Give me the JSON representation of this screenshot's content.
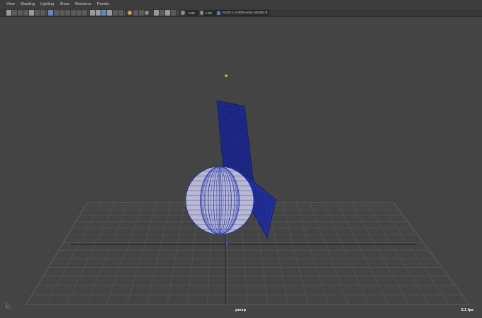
{
  "menu": {
    "items": [
      "View",
      "Shading",
      "Lighting",
      "Show",
      "Renderer",
      "Panels"
    ]
  },
  "toolbar": {
    "exposure": "0.00",
    "gamma": "1.00",
    "color_space": "ACES 1.0 SDR-video (sRGB)"
  },
  "viewport": {
    "camera": "persp",
    "fps": "5.1 fps"
  },
  "colors": {
    "viewport_bg": "#444444",
    "grid_line": "#5a5a5a",
    "wireframe": "#1b2fa3",
    "sphere_fill": "#b9b9d2",
    "accent": "#5a8cc0"
  }
}
